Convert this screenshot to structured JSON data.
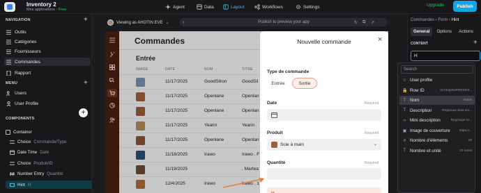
{
  "app": {
    "title": "Inventory 2",
    "subtitle": "Mes applications",
    "plan": "Free",
    "upgrade_label": "Upgrade",
    "publish_label": "Publish"
  },
  "nav": {
    "agent": "Agent",
    "data": "Data",
    "layout": "Layout",
    "workflows": "Workflows",
    "settings": "Settings"
  },
  "sidebar": {
    "navigation_title": "NAVIGATION",
    "navigation_items": [
      "Outils",
      "Catégories",
      "Fournisseurs",
      "Commandes",
      "Rapport"
    ],
    "menu_title": "MENU",
    "menu_items": [
      "Users",
      "User Profile"
    ],
    "components_title": "COMPONENTS",
    "components": [
      {
        "label": "Container",
        "detail": ""
      },
      {
        "label": "Choice",
        "detail": "Commande/Type"
      },
      {
        "label": "Date Time",
        "detail": "Date"
      },
      {
        "label": "Choice",
        "detail": "Produit/ID"
      },
      {
        "label": "Number Entry",
        "detail": "Quantité"
      },
      {
        "label": "Hint",
        "detail": "H"
      }
    ]
  },
  "canvas": {
    "viewing_as": "Viewing as AHOTIN EVE",
    "preview_placeholder": "Publish to preview your app"
  },
  "preview": {
    "page_title": "Commandes",
    "section_title": "Entrée",
    "columns": [
      "IMAGE",
      "DATE",
      "NOM",
      "TITRE"
    ],
    "rows": [
      {
        "date": "11/17/2025",
        "nom": "GoodSilron",
        "titre": "GoodSil",
        "thumb": "#7a8fb0"
      },
      {
        "date": "11/17/2025",
        "nom": "Openlane",
        "titre": "Openlan",
        "thumb": "#a0603a"
      },
      {
        "date": "11/17/2025",
        "nom": "Openlane",
        "titre": "Openlan",
        "thumb": "#9c5c36"
      },
      {
        "date": "11/17/2025",
        "nom": "Yearin",
        "titre": "Yearin .",
        "thumb": "#b08a5a"
      },
      {
        "date": "11/17/2025",
        "nom": "Openlane",
        "titre": "Openlan",
        "thumb": "#8a5230"
      },
      {
        "date": "11/18/2025",
        "nom": "Irawo",
        "titre": "Irawo . F",
        "thumb": "#2a4f7a"
      },
      {
        "date": "11/19/2025",
        "nom": "",
        "titre": ". Martea",
        "thumb": "#6b4a35"
      },
      {
        "date": "12/4/2025",
        "nom": "Irawo",
        "titre": "Irawo . 1",
        "thumb": "#b36b3a"
      }
    ]
  },
  "modal": {
    "title": "Nouvelle commande",
    "type_label": "Type de commande",
    "type_options": [
      "Entrée",
      "Sortie"
    ],
    "date_label": "Date",
    "required": "Required",
    "produit_label": "Produit",
    "produit_value": "Scie à main",
    "quantite_label": "Quantité",
    "hint_text": "H"
  },
  "right_panel": {
    "breadcrumb": [
      "Commandes",
      "Form",
      "Hint"
    ],
    "tabs": [
      "General",
      "Options",
      "Actions"
    ],
    "content_label": "CONTENT",
    "hint_value": "H"
  },
  "dropdown": {
    "search_placeholder": "Search",
    "items": [
      {
        "label": "User profile",
        "sub": "",
        "icon": "user-icon"
      },
      {
        "label": "Row ID",
        "sub": "tmYbop9xRROSD3...",
        "icon": "lock-icon"
      },
      {
        "label": "Nom",
        "sub": "Outils",
        "icon": "text-icon"
      },
      {
        "label": "Description",
        "sub": "Regroupe tous les...",
        "icon": "text-icon"
      },
      {
        "label": "Mini description",
        "sub": "Regroupe to...",
        "icon": "code-icon"
      },
      {
        "label": "Image de couverture",
        "sub": "https://...",
        "icon": "image-icon"
      },
      {
        "label": "Nombre d'éléments",
        "sub": "18",
        "icon": "number-icon"
      },
      {
        "label": "Nombre et unité",
        "sub": "10 outils",
        "icon": "text-icon"
      }
    ]
  },
  "colors": {
    "accent": "#0ea5e9",
    "brand_dark": "#4a1f10",
    "sortie_bg": "#fdeee8",
    "hint_bg": "#fde8e2",
    "annotation": "#f07a3a"
  }
}
